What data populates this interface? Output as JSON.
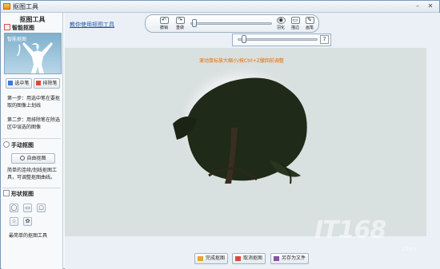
{
  "window": {
    "title": "抠图工具",
    "controls": {
      "minimize": "–",
      "close": "✕"
    }
  },
  "sidebar": {
    "title": "抠图工具",
    "smart": {
      "heading": "智能抠图",
      "thumb_label": "智能抠图",
      "select_pen": "选中笔",
      "exclude_pen": "排除笔",
      "step1": "第一步：用选中笔在要抠取的图像上划线",
      "step2": "第二步：用排除笔在除选区中误选的图像"
    },
    "manual": {
      "heading": "手动抠图",
      "free_button": "自由抠图",
      "desc": "简单的连续/划线抠图工具，可调整抠图曲线。"
    },
    "shape": {
      "heading": "形状抠图",
      "desc": "最简单的抠图工具",
      "icons": [
        "ellipse-icon",
        "rect-icon",
        "rounded-rect-icon",
        "star-icon",
        "gear-shape-icon"
      ]
    }
  },
  "help_link": "教你使用抠图工具",
  "toolbar": {
    "undo": "撤销",
    "redo": "重做",
    "feather": "羽化",
    "stroke": "描边",
    "brush": "画笔",
    "zoom_value": 0.02
  },
  "subpanel": {
    "value_label": "7",
    "slider_value": 0.05
  },
  "canvas": {
    "hint": "滚动鼠标放大缩小/按Ctrl+Z撤回前调整",
    "watermark": "IT168",
    "watermark_domain": ".com"
  },
  "bottom_buttons": {
    "done": "完成抠图",
    "cancel": "取消抠图",
    "save_as": "另存为文件"
  },
  "colors": {
    "accent_link": "#2255aa",
    "hint": "#e06a00",
    "stage": "#d9e0e0"
  }
}
